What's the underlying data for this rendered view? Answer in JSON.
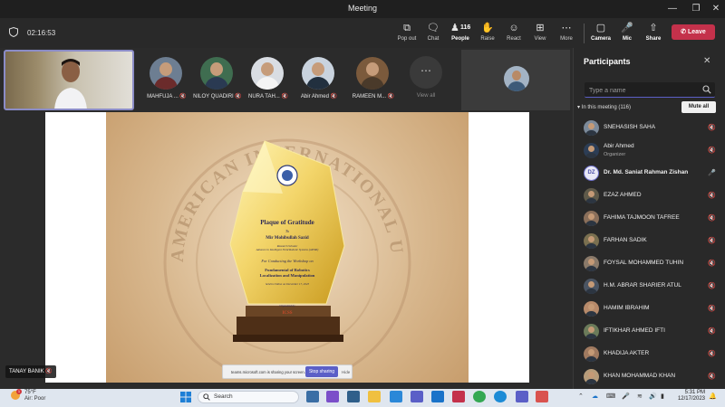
{
  "window": {
    "title": "Meeting"
  },
  "toolbar": {
    "timer": "02:16:53",
    "buttons": [
      {
        "label": "Pop out",
        "icon": "pop-out-icon"
      },
      {
        "label": "Chat",
        "icon": "chat-icon"
      },
      {
        "label": "People",
        "icon": "people-icon"
      },
      {
        "label": "Raise",
        "icon": "raise-hand-icon"
      },
      {
        "label": "React",
        "icon": "react-icon"
      },
      {
        "label": "View",
        "icon": "view-icon"
      },
      {
        "label": "More",
        "icon": "more-icon"
      },
      {
        "label": "Camera",
        "icon": "camera-off-icon"
      },
      {
        "label": "Mic",
        "icon": "mic-off-icon"
      },
      {
        "label": "Share",
        "icon": "share-icon"
      }
    ],
    "people_count": "116",
    "leave_label": "Leave"
  },
  "gallery": {
    "participants": [
      {
        "name": "MAHFUJA ..."
      },
      {
        "name": "NILOY QUADIRI"
      },
      {
        "name": "NURA TAH..."
      },
      {
        "name": "Abir Ahmed"
      },
      {
        "name": "RAMEEN M..."
      }
    ],
    "view_all_label": "View all"
  },
  "slide": {
    "seal_text": "AMERICAN INTERNATIONAL UNIVERSITY",
    "title": "Plaque of Gratitude",
    "to": "To",
    "recipient": "Mir Mohibullah Sazid",
    "role_line1": "Research Scholar",
    "role_line2": "Advance in Intelligent Field Robotic Systems (AIFRS)",
    "for_line": "For Conducting the Workshop on",
    "workshop_line1": "Fundamental of Robotics",
    "workshop_line2": "Localization and Manipulation",
    "held_line": "held in Online on December 17, 2023",
    "organized_by": "Organized by",
    "org_logo": "ICSS"
  },
  "share_bar": {
    "text": "teams.microsoft.com is sharing your screen.",
    "stop_label": "Stop sharing",
    "hide_label": "Hide"
  },
  "self_name_tag": "TANAY BANIK",
  "panel": {
    "title": "Participants",
    "search_placeholder": "Type a name",
    "section_label": "In this meeting (116)",
    "mute_all_label": "Mute all",
    "rows": [
      {
        "name": "SNEHASISH SAHA",
        "role": ""
      },
      {
        "name": "Abir Ahmed",
        "role": "Organizer"
      },
      {
        "name": "Dr. Md. Saniat Rahman Zishan",
        "role": "",
        "initials": "DZ"
      },
      {
        "name": "EZAZ AHMED",
        "role": ""
      },
      {
        "name": "FAHIMA TAJMOON TAFREE",
        "role": ""
      },
      {
        "name": "FARHAN SADIK",
        "role": ""
      },
      {
        "name": "FOYSAL MOHAMMED TUHIN",
        "role": ""
      },
      {
        "name": "H.M. ABRAR SHARIER ATUL",
        "role": ""
      },
      {
        "name": "HAMIM IBRAHIM",
        "role": ""
      },
      {
        "name": "IFTIKHAR AHMED IFTI",
        "role": ""
      },
      {
        "name": "KHADIJA AKTER",
        "role": ""
      },
      {
        "name": "KHAN MOHAMMAD KHAN",
        "role": ""
      }
    ]
  },
  "taskbar": {
    "weather_temp": "75°F",
    "weather_desc": "Air: Poor",
    "weather_badge": "1",
    "search_label": "Search",
    "time": "5:31 PM",
    "date": "12/17/2023"
  },
  "colors": {
    "leave": "#c4314b",
    "accent": "#5b5fc7",
    "taskbar": "#dfe6ef"
  }
}
